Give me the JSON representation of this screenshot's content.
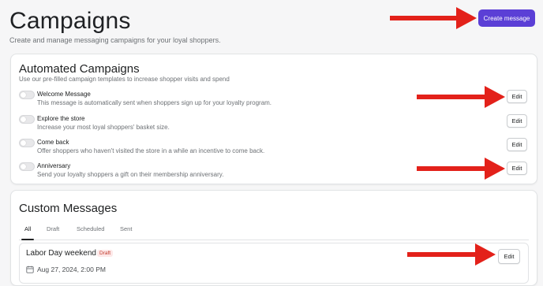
{
  "header": {
    "title": "Campaigns",
    "subtitle": "Create and manage messaging campaigns for your loyal shoppers.",
    "create_label": "Create message"
  },
  "automated": {
    "title": "Automated Campaigns",
    "description": "Use our pre-filled campaign templates to increase shopper visits and spend",
    "items": [
      {
        "name": "Welcome Message",
        "description": "This message is automatically sent when shoppers sign up for your loyalty program.",
        "edit_label": "Edit",
        "enabled": false
      },
      {
        "name": "Explore the store",
        "description": "Increase your most loyal shoppers' basket size.",
        "edit_label": "Edit",
        "enabled": false
      },
      {
        "name": "Come back",
        "description": "Offer shoppers who haven't visited the store in a while an incentive to come back.",
        "edit_label": "Edit",
        "enabled": false
      },
      {
        "name": "Anniversary",
        "description": "Send your loyalty shoppers a gift on their membership anniversary.",
        "edit_label": "Edit",
        "enabled": false
      }
    ]
  },
  "custom": {
    "title": "Custom Messages",
    "tabs": [
      {
        "label": "All",
        "active": true
      },
      {
        "label": "Draft",
        "active": false
      },
      {
        "label": "Scheduled",
        "active": false
      },
      {
        "label": "Sent",
        "active": false
      }
    ],
    "messages": [
      {
        "title": "Labor Day weekend",
        "status": "Draft",
        "date": "Aug 27, 2024, 2:00 PM",
        "edit_label": "Edit"
      }
    ]
  },
  "colors": {
    "accent": "#5b3fd6",
    "annotation_arrow": "#e3211a",
    "draft_badge": "#c0392b"
  },
  "icons": {
    "calendar": "calendar-icon",
    "arrow": "annotation-arrow"
  }
}
